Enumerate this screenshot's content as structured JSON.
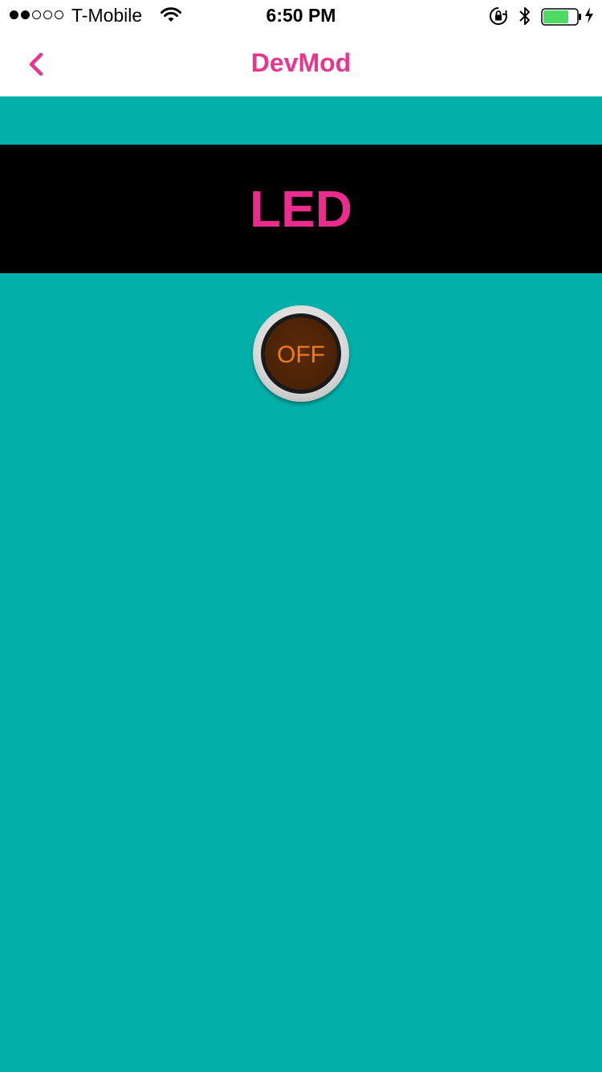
{
  "status_bar": {
    "carrier": "T-Mobile",
    "time": "6:50 PM",
    "signal_bars_filled": 2,
    "signal_bars_total": 5,
    "battery_level": 0.75,
    "icons": [
      "wifi-icon",
      "rotation-lock-icon",
      "bluetooth-icon",
      "battery-icon",
      "charging-bolt-icon"
    ]
  },
  "nav": {
    "title": "DevMod",
    "back_icon": "chevron-left-icon"
  },
  "banner": {
    "title": "LED"
  },
  "toggle": {
    "label": "OFF"
  },
  "colors": {
    "accent": "#e8368f",
    "background": "#02b0a9",
    "banner_bg": "#000000",
    "toggle_text": "#f07a1e"
  }
}
